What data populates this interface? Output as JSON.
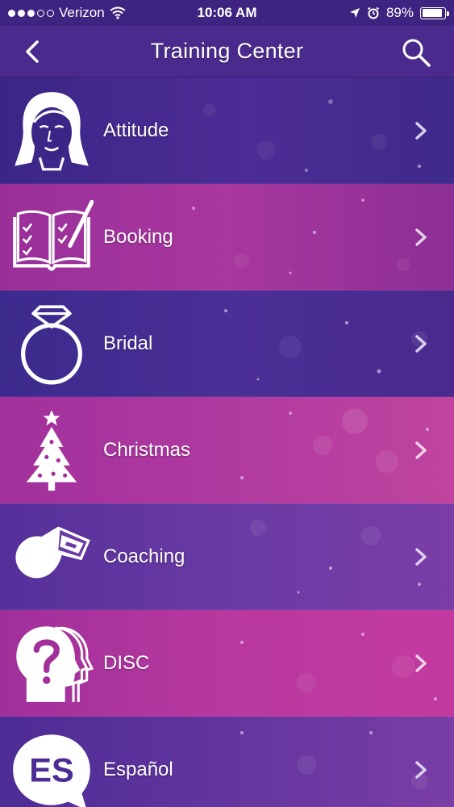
{
  "status_bar": {
    "carrier": "Verizon",
    "time": "10:06 AM",
    "battery": "89%",
    "battery_level": 0.89,
    "signal_bars_filled": 3,
    "signal_bars_total": 5
  },
  "nav": {
    "title": "Training Center",
    "back_icon": "chevron-left-icon",
    "search_icon": "search-icon"
  },
  "colors": {
    "purple_dark": "#3f2a8a",
    "purple_mid": "#5a2f9e",
    "magenta": "#a8379e",
    "pink": "#c33a9f"
  },
  "items": [
    {
      "label": "Attitude",
      "icon": "woman-face-icon"
    },
    {
      "label": "Booking",
      "icon": "open-book-checklist-icon"
    },
    {
      "label": "Bridal",
      "icon": "diamond-ring-icon"
    },
    {
      "label": "Christmas",
      "icon": "christmas-tree-icon"
    },
    {
      "label": "Coaching",
      "icon": "whistle-icon"
    },
    {
      "label": "DISC",
      "icon": "head-question-icon"
    },
    {
      "label": "Español",
      "icon": "es-speech-bubble-icon"
    }
  ]
}
